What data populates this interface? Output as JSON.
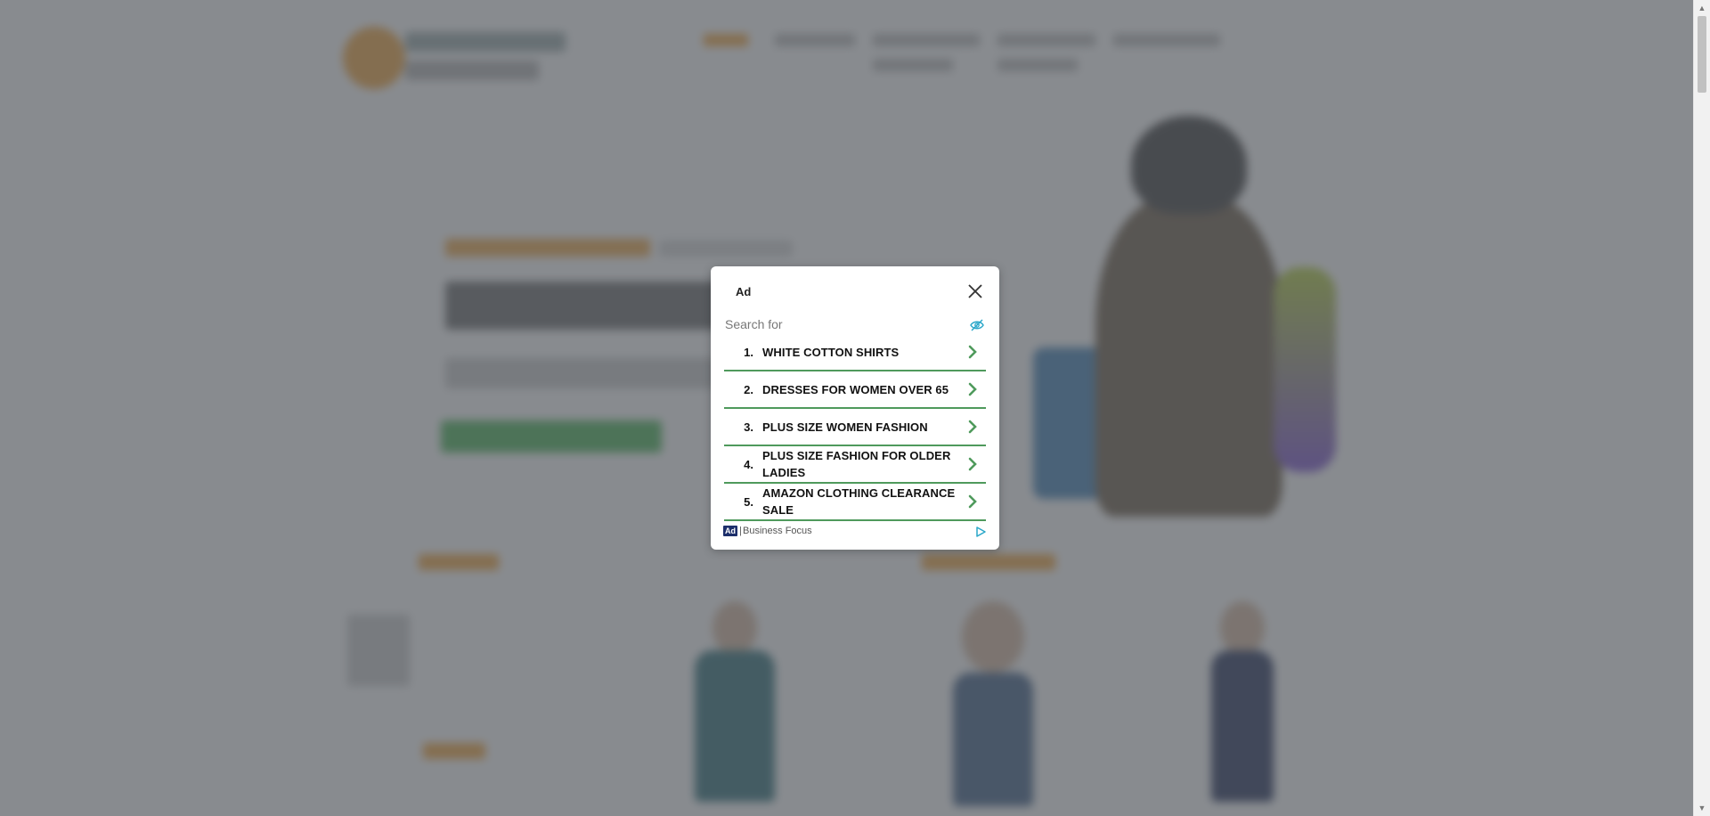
{
  "modal": {
    "ad_label": "Ad",
    "search_prefix": "Search for",
    "items": [
      {
        "num": "1.",
        "text": "WHITE COTTON SHIRTS"
      },
      {
        "num": "2.",
        "text": "DRESSES FOR WOMEN OVER 65"
      },
      {
        "num": "3.",
        "text": "PLUS SIZE WOMEN FASHION"
      },
      {
        "num": "4.",
        "text": "PLUS SIZE FASHION FOR OLDER LADIES"
      },
      {
        "num": "5.",
        "text": "AMAZON CLOTHING CLEARANCE SALE"
      }
    ],
    "footer_badge": "Ad",
    "footer_separator": "|",
    "footer_brand": "Business Focus"
  },
  "icons": {
    "close": "close-icon",
    "hide": "eye-slash-icon",
    "chevron": "chevron-right-icon",
    "adchoices": "adchoices-icon"
  },
  "colors": {
    "accent_green": "#4f9a5c",
    "eye_blue": "#2aa7c9",
    "badge_navy": "#1d2f6b",
    "overlay": "rgba(80,84,90,0.68)"
  }
}
